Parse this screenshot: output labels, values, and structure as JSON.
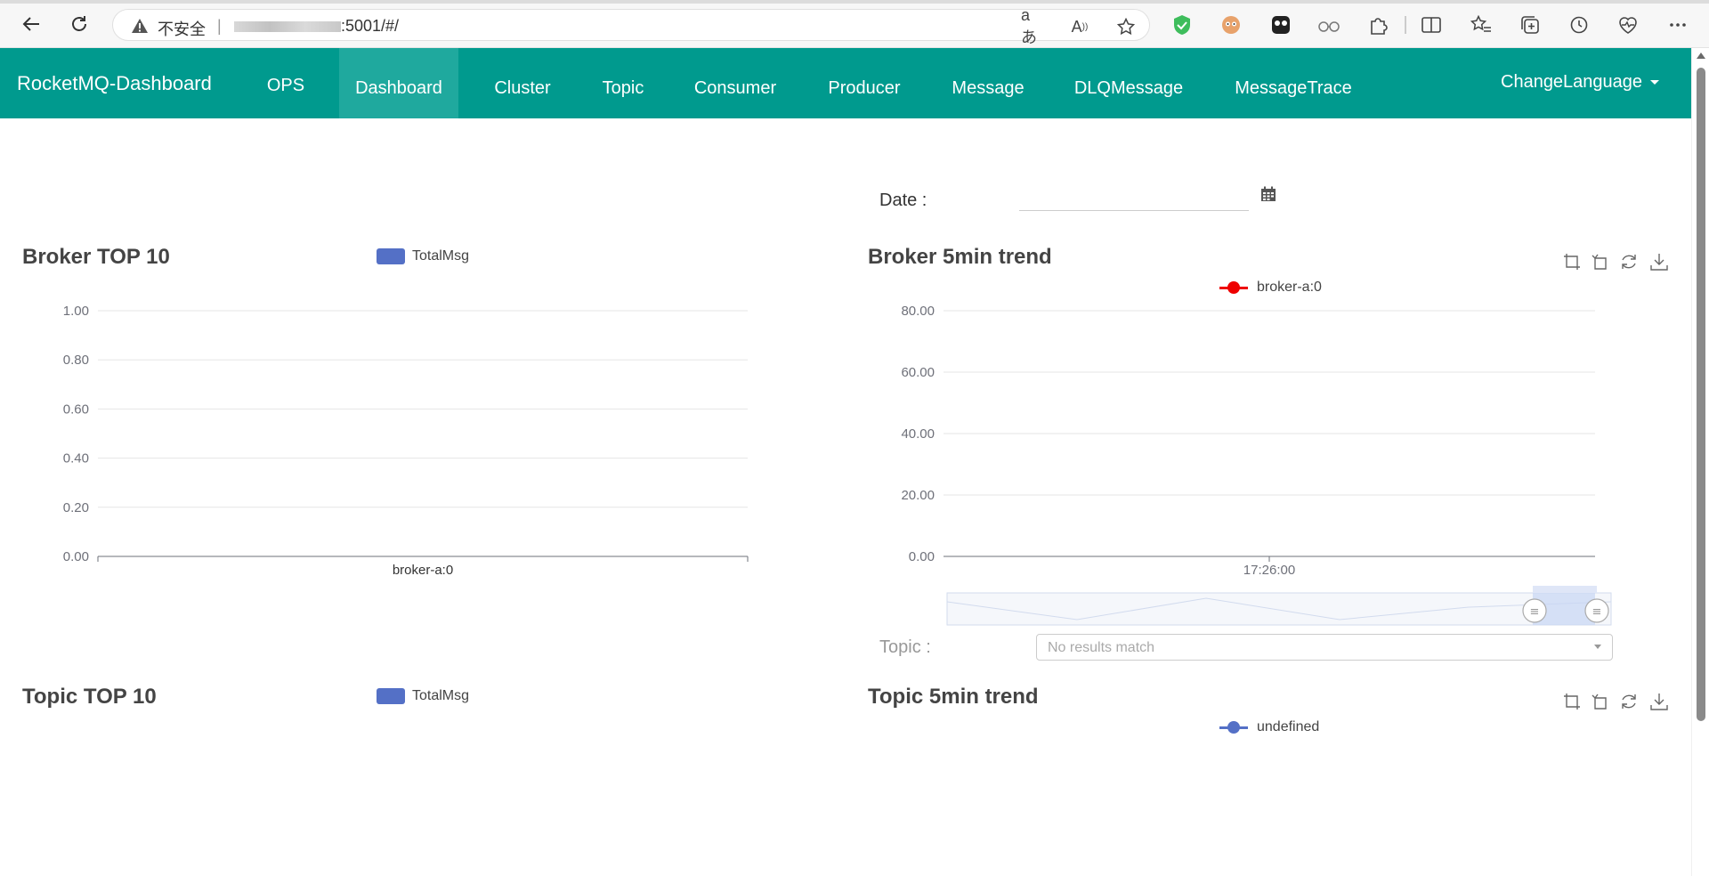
{
  "browser": {
    "insecure_label": "不安全",
    "separator": "|",
    "url_suffix": ":5001/#/"
  },
  "navbar": {
    "brand": "RocketMQ-Dashboard",
    "items": [
      {
        "label": "OPS"
      },
      {
        "label": "Dashboard",
        "active": true
      },
      {
        "label": "Cluster"
      },
      {
        "label": "Topic"
      },
      {
        "label": "Consumer"
      },
      {
        "label": "Producer"
      },
      {
        "label": "Message"
      },
      {
        "label": "DLQMessage"
      },
      {
        "label": "MessageTrace"
      }
    ],
    "change_language": "ChangeLanguage"
  },
  "date_filter": {
    "label": "Date :",
    "value": ""
  },
  "topic_filter": {
    "label": "Topic :",
    "placeholder": "No results match"
  },
  "colors": {
    "navbar": "#009a8e",
    "navbar_active": "#1fa99e",
    "bar": "#5470c6",
    "broker_line": "#ee0000",
    "topic_line": "#5470c6"
  },
  "chart_data": [
    {
      "type": "bar",
      "title": "Broker TOP 10",
      "legend": [
        "TotalMsg"
      ],
      "categories": [
        "broker-a:0"
      ],
      "series": [
        {
          "name": "TotalMsg",
          "values": [
            0
          ]
        }
      ],
      "yticks": [
        "1.00",
        "0.80",
        "0.60",
        "0.40",
        "0.20",
        "0.00"
      ],
      "ylim": [
        0,
        1
      ]
    },
    {
      "type": "line",
      "title": "Broker 5min trend",
      "legend": [
        "broker-a:0"
      ],
      "xticks": [
        "17:26:00"
      ],
      "series": [
        {
          "name": "broker-a:0",
          "values": []
        }
      ],
      "yticks": [
        "80.00",
        "60.00",
        "40.00",
        "20.00",
        "0.00"
      ],
      "ylim": [
        0,
        80
      ]
    },
    {
      "type": "bar",
      "title": "Topic TOP 10",
      "legend": [
        "TotalMsg"
      ],
      "series": [
        {
          "name": "TotalMsg",
          "values": []
        }
      ]
    },
    {
      "type": "line",
      "title": "Topic 5min trend",
      "legend": [
        "undefined"
      ],
      "series": [
        {
          "name": "undefined",
          "values": []
        }
      ]
    }
  ]
}
